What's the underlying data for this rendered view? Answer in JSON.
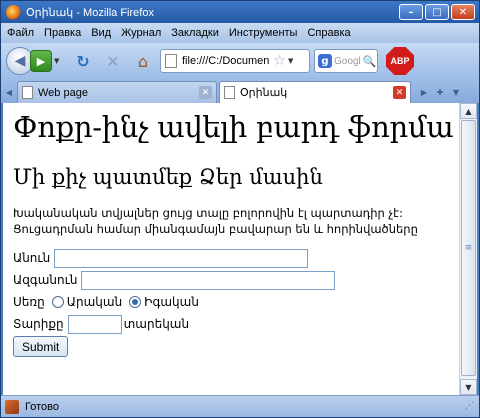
{
  "window": {
    "title": "Օրինակ - Mozilla Firefox",
    "buttons": {
      "minimize": "–",
      "maximize": "□",
      "close": "✕"
    }
  },
  "menubar": {
    "items": [
      "Файл",
      "Правка",
      "Вид",
      "Журнал",
      "Закладки",
      "Инструменты",
      "Справка"
    ]
  },
  "navbar": {
    "url": "file:///C:/Documen",
    "search_placeholder": "Googl",
    "search_engine_letter": "g",
    "abp_label": "ABP"
  },
  "tabs": [
    {
      "label": "Web page",
      "active": false
    },
    {
      "label": "Օրինակ",
      "active": true
    }
  ],
  "page": {
    "h1": "Փոքր-ինչ ավելի բարդ ֆորմա",
    "h2": "Մի քիչ պատմեք Ձեր մասին",
    "paragraph_line1": "Խականական տվյալներ ցույց տալը բոլորովին էլ պարտադիր չէ:",
    "paragraph_line2": "Ցուցադրման համար միանգամայն բավարար են և հորինվածները",
    "form": {
      "first_name_label": "Անուն",
      "first_name_value": "",
      "last_name_label": "Ազգանուն",
      "last_name_value": "",
      "gender_label": "Սեռը",
      "gender_options": [
        "Արական",
        "Իգական"
      ],
      "gender_selected": "Իգական",
      "age_label": "Տարիքը",
      "age_value": "",
      "age_suffix": "տարեկան",
      "submit_label": "Submit"
    }
  },
  "status": {
    "text": "Готово"
  },
  "colors": {
    "titlebar": "#2459a6",
    "toolbar": "#a9c4e8",
    "input_border": "#7aa0c8",
    "abp_red": "#d21b1b",
    "close_tab_red": "#d23a2a"
  }
}
